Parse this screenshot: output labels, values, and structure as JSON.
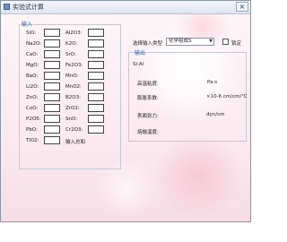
{
  "window": {
    "title": "实验式计算",
    "close_symbol": "×"
  },
  "input": {
    "title": "输入",
    "left_labels": [
      "SiO:",
      "Na2O:",
      "CaO:",
      "MgO:",
      "BaO:",
      "Li2O:",
      "ZnO:",
      "CoO:",
      "P2O5:",
      "PbO:",
      "TiO2:"
    ],
    "right_labels": [
      "Al2O3:",
      "K2O:",
      "SrO:",
      "Fe2O3:",
      "MnO:",
      "MnO2:",
      "B2O3:",
      "ZrO2:",
      "SnO:",
      "Cr2O3:",
      "输入总和"
    ]
  },
  "controls": {
    "select_label": "选择输入类型",
    "select_value": "化学组成S",
    "checkbox_label": "锁定"
  },
  "output": {
    "title": "输出",
    "line1": "Si:Al",
    "visc_label": "高温粘度:",
    "visc_value": "Pa·s",
    "exp_label": "膨胀系数:",
    "exp_value": "×10-6 cm/cm/℃",
    "surface_label": "表面张力:",
    "surface_value": "dyn/cm",
    "melt_label": "熔融温度:"
  }
}
